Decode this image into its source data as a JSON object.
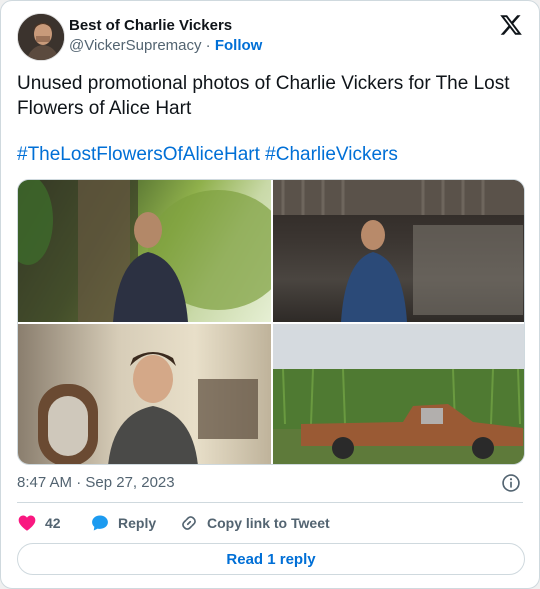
{
  "author": {
    "display_name": "Best of Charlie Vickers",
    "handle": "@VickerSupremacy",
    "separator": "·",
    "follow_label": "Follow"
  },
  "tweet": {
    "text": "Unused promotional photos of Charlie Vickers for The Lost Flowers of Alice Hart",
    "hashtags": [
      "#TheLostFlowersOfAliceHart",
      "#CharlieVickers"
    ],
    "timestamp": "8:47 AM · Sep 27, 2023"
  },
  "actions": {
    "like_count": "42",
    "reply_label": "Reply",
    "copy_link_label": "Copy link to Tweet"
  },
  "footer": {
    "read_replies_label": "Read 1 reply"
  },
  "colors": {
    "link_blue": "#006fd6",
    "like_pink": "#f91880",
    "muted_gray": "#536471",
    "border": "#cfd9de"
  },
  "icons": {
    "brand": "x-logo-icon",
    "info": "info-icon",
    "like": "heart-icon",
    "reply": "speech-bubble-icon",
    "copy": "link-icon"
  }
}
